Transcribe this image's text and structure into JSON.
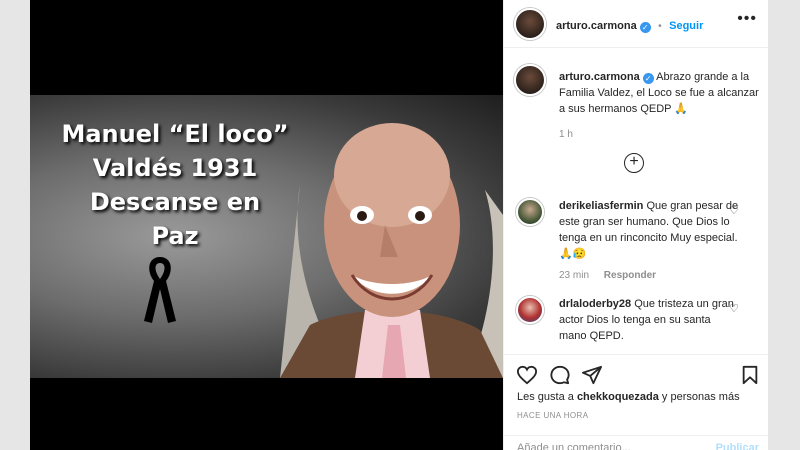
{
  "post": {
    "image_text": [
      "Manuel “El loco”",
      "Valdés 1931",
      "Descanse en",
      "Paz"
    ]
  },
  "header": {
    "username": "arturo.carmona",
    "separator": "•",
    "follow_label": "Seguir",
    "more_icon": "more-options-icon"
  },
  "caption": {
    "username": "arturo.carmona",
    "text": "Abrazo grande a la Familia Valdez, el Loco se fue a alcanzar a sus hermanos QEDP 🙏",
    "time": "1 h"
  },
  "load_more_icon": "plus-circle-icon",
  "comments": [
    {
      "username": "derikeliasfermin",
      "text": "Que gran pesar de este gran ser humano. Que Dios lo tenga en un rinconcito Muy especial. 🙏😥",
      "time": "23 min",
      "reply_label": "Responder"
    },
    {
      "username": "drlaloderby28",
      "text": "Que tristeza un gran actor Dios lo tenga en su santa mano QEPD."
    }
  ],
  "actions": {
    "likes_prefix": "Les gusta a",
    "likes_user": "chekkoquezada",
    "likes_suffix": "y personas más",
    "timestamp": "HACE UNA HORA"
  },
  "add_comment": {
    "placeholder": "Añade un comentario...",
    "post_label": "Publicar"
  },
  "colors": {
    "accent": "#0095f6",
    "verified": "#3897f0",
    "muted": "#8e8e8e"
  }
}
